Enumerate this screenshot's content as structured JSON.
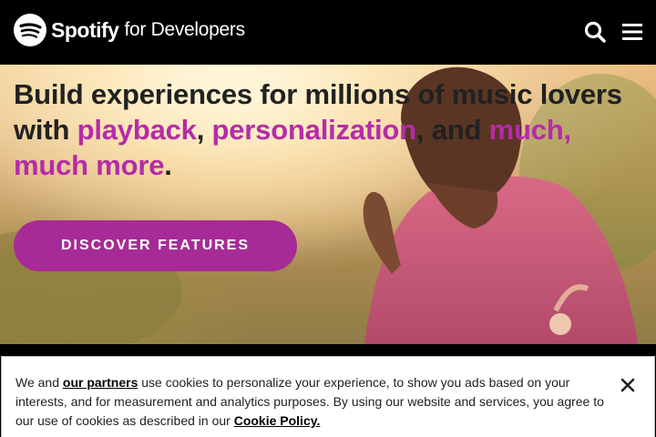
{
  "header": {
    "brand": "Spotify",
    "brand_suffix": "for Developers",
    "icons": [
      "spotify-logo-icon",
      "search-icon",
      "menu-icon"
    ]
  },
  "hero": {
    "headline_parts": [
      "Build experiences for millions of music lovers with ",
      "playback",
      ", ",
      "personalization",
      ", and ",
      "much, much more",
      "."
    ],
    "cta_label": "DISCOVER FEATURES",
    "accent_color": "#b62ba8",
    "button_color": "#a72b96"
  },
  "cookie_banner": {
    "text_1": "We and ",
    "partners_link": "our partners",
    "text_2": " use cookies to personalize your experience, to show you ads based on your interests, and for measurement and analytics purposes. By using our website and services, you agree to our use of cookies as described in our ",
    "policy_link": "Cookie Policy.",
    "close_icon": "close-icon"
  }
}
